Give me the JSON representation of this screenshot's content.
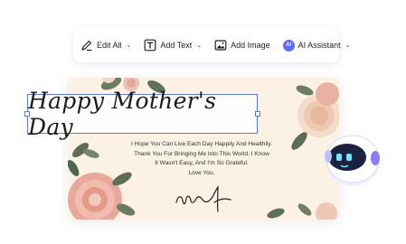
{
  "toolbar": {
    "edit_all": "Edit All",
    "add_text": "Add Text",
    "add_image": "Add Image",
    "ai_assistant": "AI Assistant",
    "ai_badge": "AI"
  },
  "card": {
    "title": "Happy Mother's Day",
    "message": [
      "I Hope You Can Live Each Day Happily And Healthily.",
      "Thank You For Bringing Me Into This World. I Know",
      "It Wasn't Easy, And I'm So Grateful.",
      "Love You."
    ]
  },
  "colors": {
    "card_bg": "#fbf1e4",
    "selection": "#5b7bd6",
    "ai_gradient_start": "#7a5cff",
    "ai_gradient_end": "#3f7bff"
  },
  "icons": [
    "edit-icon",
    "text-icon",
    "image-icon",
    "ai-assistant-icon",
    "chevron-down-icon",
    "robot-mascot"
  ]
}
